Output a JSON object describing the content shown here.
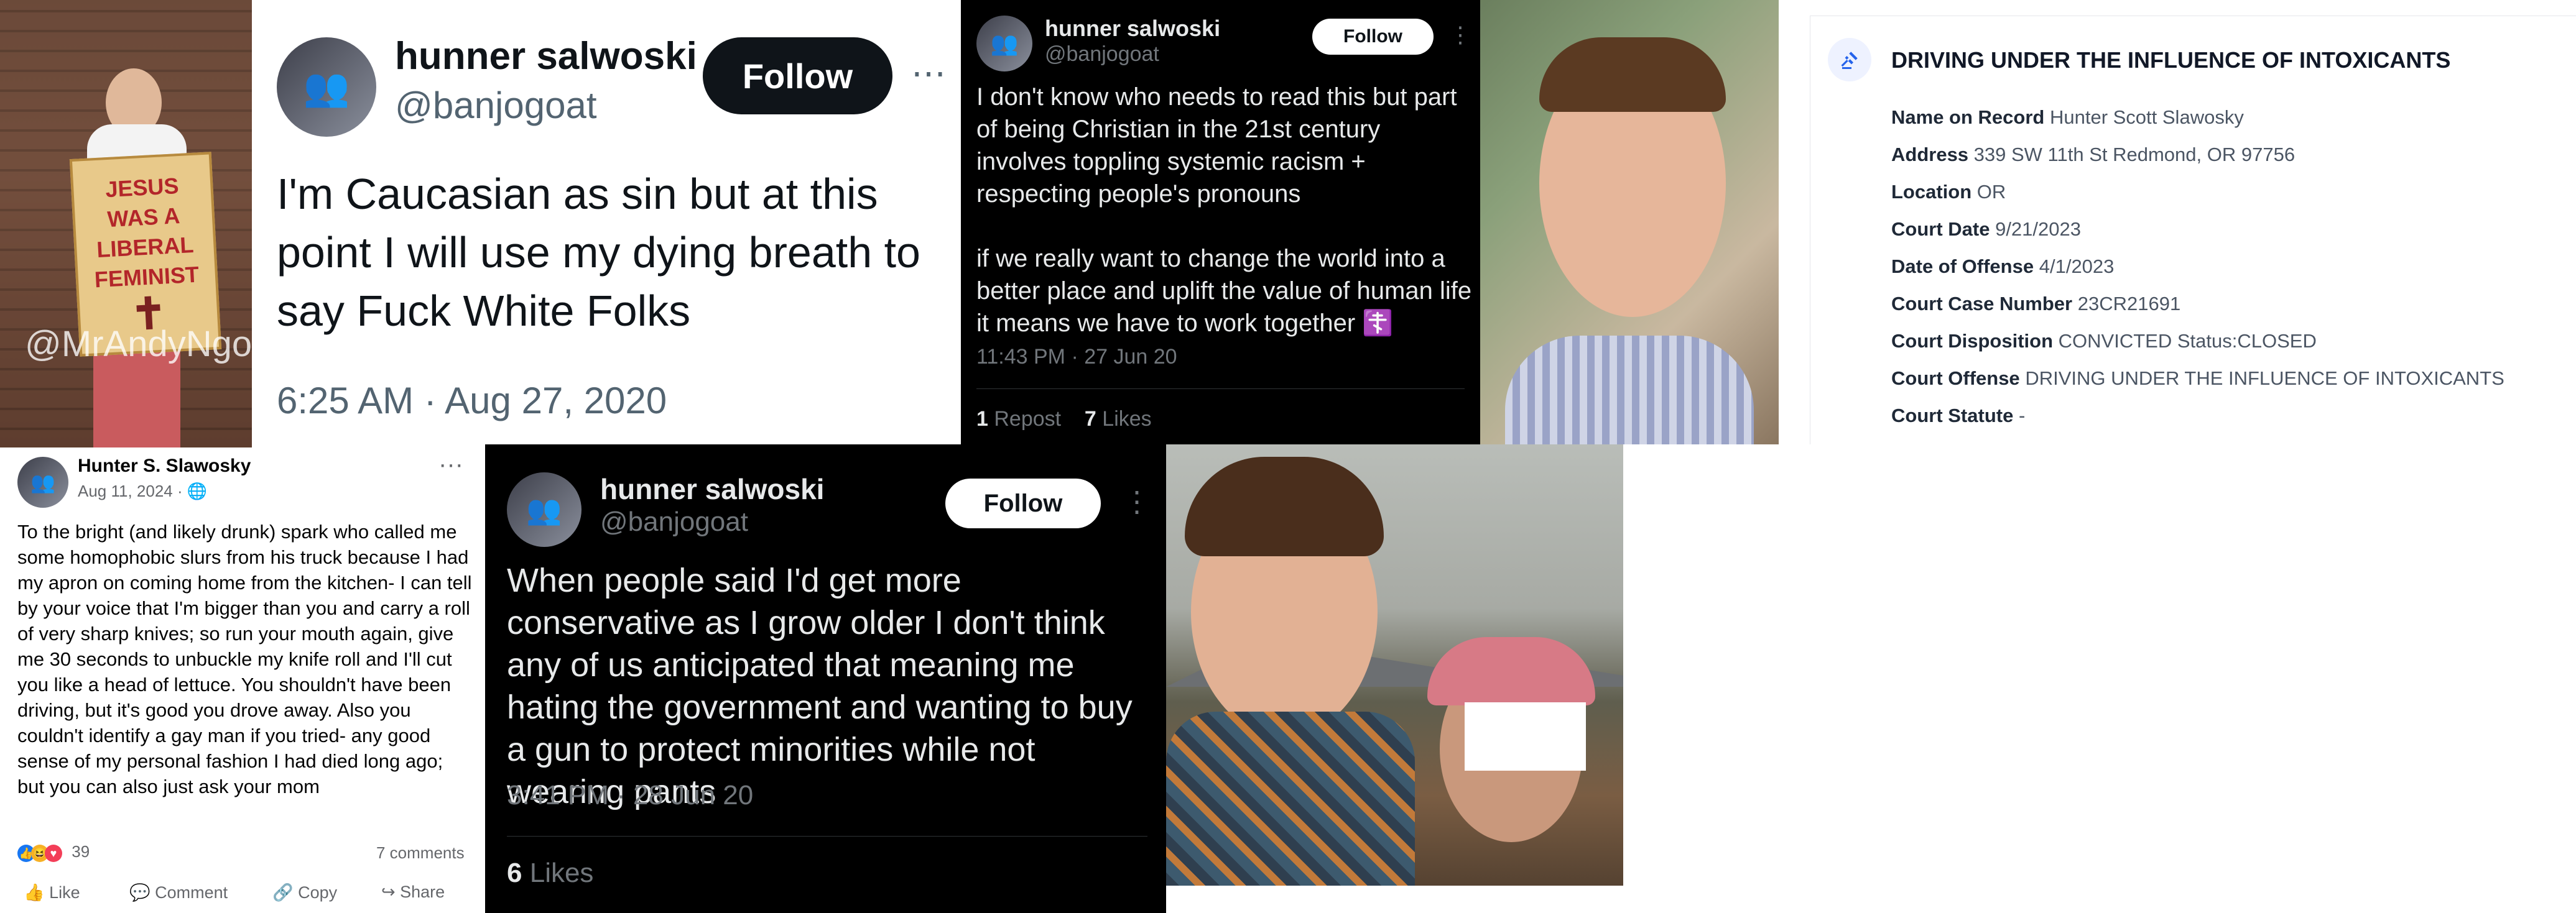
{
  "photo_protest": {
    "sign_lines": [
      "JESUS",
      "WAS A",
      "LIBERAL",
      "FEMINIST"
    ],
    "watermark": "@MrAndyNgo"
  },
  "tweet_caucasian": {
    "display_name": "hunner salwoski",
    "handle": "@banjogoat",
    "follow_label": "Follow",
    "more_icon": "⋯",
    "body": "I'm Caucasian as sin but at this point I will use my dying breath to say Fuck White Folks",
    "timestamp": "6:25 AM · Aug 27, 2020"
  },
  "tweet_christian": {
    "display_name": "hunner salwoski",
    "handle": "@banjogoat",
    "follow_label": "Follow",
    "more_icon": "⋮",
    "body": "I don't know who needs to read this but part of being Christian in the 21st century involves toppling systemic racism + respecting people's pronouns\n\nif we really want to change the world into a better place and uplift the value of human life it means we have to work together ☦️",
    "timestamp": "11:43 PM · 27 Jun 20",
    "reposts_count": "1",
    "reposts_label": "Repost",
    "likes_count": "7",
    "likes_label": "Likes"
  },
  "court_record": {
    "title": "DRIVING UNDER THE INFLUENCE OF INTOXICANTS",
    "rows": [
      {
        "label": "Name on Record",
        "value": "Hunter Scott Slawosky"
      },
      {
        "label": "Address",
        "value": "339 SW 11th St Redmond, OR 97756"
      },
      {
        "label": "Location",
        "value": "OR"
      },
      {
        "label": "Court Date",
        "value": "9/21/2023"
      },
      {
        "label": "Date of Offense",
        "value": "4/1/2023"
      },
      {
        "label": "Court Case Number",
        "value": "23CR21691"
      },
      {
        "label": "Court Disposition",
        "value": "CONVICTED Status:CLOSED"
      },
      {
        "label": "Court Offense",
        "value": "DRIVING UNDER THE INFLUENCE OF INTOXICANTS"
      },
      {
        "label": "Court Statute",
        "value": "-"
      }
    ]
  },
  "fb_post": {
    "author": "Hunter S. Slawosky",
    "date": "Aug 11, 2024 ·",
    "more_icon": "···",
    "body": "To the bright (and likely drunk) spark who called me some homophobic slurs from his truck because I had my apron on coming home from the kitchen- I can tell by your voice that I'm bigger than you and carry a roll of very sharp knives; so run your mouth again, give me 30 seconds to unbuckle my knife roll and I'll cut you like a head of lettuce. You shouldn't have been driving, but it's good you drove away. Also you couldn't identify a gay man if you tried- any good sense of my personal fashion I had died long ago; but you can also just ask your mom",
    "reactions_count": "39",
    "comments": "7 comments",
    "actions": {
      "like": "Like",
      "comment": "Comment",
      "copy": "Copy",
      "share": "Share"
    }
  },
  "tweet_conservative": {
    "display_name": "hunner salwoski",
    "handle": "@banjogoat",
    "follow_label": "Follow",
    "more_icon": "⋮",
    "body": "When people said I'd get more conservative as I grow older I don't think any of us anticipated that meaning me hating the government and wanting to buy a gun to protect minorities while not wearing pants",
    "timestamp": "3:41 PM · 28 Jun 20",
    "likes_count": "6",
    "likes_label": "Likes"
  },
  "colors": {
    "x_black": "#0f1419",
    "x_dark_bg": "#000000",
    "record_icon": "#2563eb",
    "fb_like": "#1877f2"
  }
}
